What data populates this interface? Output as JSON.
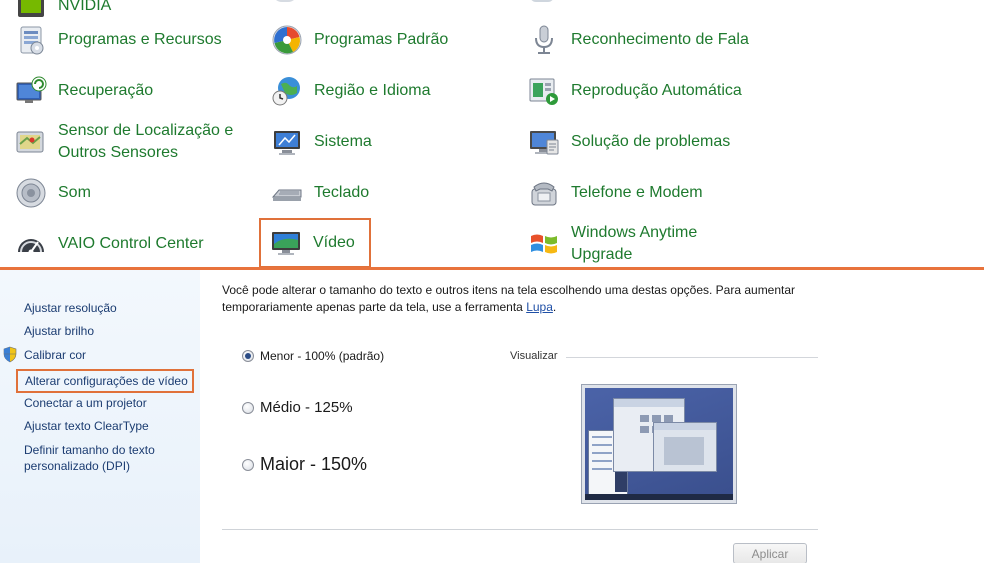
{
  "control_panel": {
    "items": [
      {
        "label": "NVIDIA",
        "icon": "nvidia-icon"
      },
      {
        "label": "Programas e Recursos",
        "icon": "programs-features-icon"
      },
      {
        "label": "Programas Padrão",
        "icon": "default-programs-icon"
      },
      {
        "label": "Reconhecimento de Fala",
        "icon": "microphone-icon"
      },
      {
        "label": "Recuperação",
        "icon": "recovery-icon"
      },
      {
        "label": "Região e Idioma",
        "icon": "globe-clock-icon"
      },
      {
        "label": "Reprodução Automática",
        "icon": "autoplay-icon"
      },
      {
        "label": "Sensor de Localização e Outros Sensores",
        "icon": "location-sensor-icon"
      },
      {
        "label": "Sistema",
        "icon": "system-monitor-icon"
      },
      {
        "label": "Solução de problemas",
        "icon": "troubleshooting-icon"
      },
      {
        "label": "Som",
        "icon": "speaker-icon"
      },
      {
        "label": "Teclado",
        "icon": "keyboard-icon"
      },
      {
        "label": "Telefone e Modem",
        "icon": "telephone-icon"
      },
      {
        "label": "VAIO Control Center",
        "icon": "vaio-gauge-icon"
      },
      {
        "label": "Vídeo",
        "icon": "display-monitor-icon"
      },
      {
        "label": "Windows Anytime Upgrade",
        "icon": "windows-flag-icon"
      }
    ]
  },
  "sidebar": {
    "links": [
      "Ajustar resolução",
      "Ajustar brilho",
      "Calibrar cor",
      "Alterar configurações de vídeo",
      "Conectar a um projetor",
      "Ajustar texto ClearType",
      "Definir tamanho do texto personalizado (DPI)"
    ]
  },
  "main": {
    "description": "Você pode alterar o tamanho do texto e outros itens na tela escolhendo uma destas opções. Para aumentar temporariamente apenas parte da tela, use a ferramenta ",
    "link": "Lupa",
    "description_end": ".",
    "options": [
      {
        "label": "Menor - 100% (padrão)",
        "checked": true
      },
      {
        "label": "Médio - 125%",
        "checked": false
      },
      {
        "label": "Maior - 150%",
        "checked": false
      }
    ],
    "preview_label": "Visualizar",
    "apply_label": "Aplicar"
  },
  "colors": {
    "item_text": "#1e7a2e",
    "highlight_border": "#e0713a",
    "sidebar_link": "#1b3c71"
  }
}
